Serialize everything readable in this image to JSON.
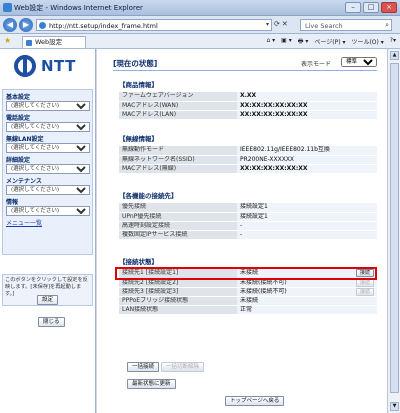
{
  "browser": {
    "window_title": "Web設定 - Windows Internet Explorer",
    "url": "http://ntt.setup/index_frame.html",
    "search_placeholder": "Live Search",
    "tab_title": "Web設定",
    "commands": [
      "⌂ ▾",
      "▣ ▾",
      "🖶 ▾",
      "ページ(P) ▾",
      "ツール(O) ▾",
      "?▾"
    ]
  },
  "left": {
    "logo_text": "NTT",
    "menu": [
      {
        "label": "基本設定",
        "select": "(選択してください)"
      },
      {
        "label": "電話設定",
        "select": "(選択してください)"
      },
      {
        "label": "無線LAN設定",
        "select": "(選択してください)"
      },
      {
        "label": "詳細設定",
        "select": "(選択してください)"
      },
      {
        "label": "メンテナンス",
        "select": "(選択してください)"
      },
      {
        "label": "情報",
        "select": "(選択してください)"
      }
    ],
    "menu_list_link": "メニュー一覧",
    "notice_text": "このボタンをクリックして設定を反映します。[未保存]を再起動します。]",
    "apply_button": "設定",
    "close_button": "閉じる"
  },
  "main": {
    "title": "[現在の状態]",
    "mode_label": "表示モード",
    "mode_value": "標準",
    "sections": {
      "product": {
        "heading": "【商品情報】",
        "rows": [
          {
            "k": "ファームウェアバージョン",
            "v": "X.XX"
          },
          {
            "k": "MACアドレス(WAN)",
            "v": "XX:XX:XX:XX:XX:XX"
          },
          {
            "k": "MACアドレス(LAN)",
            "v": "XX:XX:XX:XX:XX:XX"
          }
        ]
      },
      "wireless": {
        "heading": "【無線情報】",
        "rows": [
          {
            "k": "無線動作モード",
            "v": "IEEE802.11g/IEEE802.11b互換"
          },
          {
            "k": "無線ネットワーク名(SSID)",
            "v": "PR200NE-XXXXXX"
          },
          {
            "k": "MACアドレス(無線)",
            "v": "XX:XX:XX:XX:XX:XX"
          }
        ]
      },
      "priority": {
        "heading": "【各機能の接続先】",
        "rows": [
          {
            "k": "優先接続",
            "v": "接続設定1"
          },
          {
            "k": "UPnP優先接続",
            "v": "接続設定1"
          },
          {
            "k": "高速時刻設定接続",
            "v": "-"
          },
          {
            "k": "複数固定IPサービス接続",
            "v": "-"
          }
        ]
      },
      "connection": {
        "heading": "【接続状態】",
        "rows": [
          {
            "k": "接続先1 [接続設定1]",
            "v": "未接続",
            "action": "接続"
          },
          {
            "k": "接続先2 [接続設定2]",
            "v": "未接続(接続不可)",
            "action": "接続"
          },
          {
            "k": "接続先3 [接続設定3]",
            "v": "未接続(接続不可)",
            "action": "接続"
          },
          {
            "k": "PPPoEブリッジ接続状態",
            "v": "未接続"
          },
          {
            "k": "LAN接続状態",
            "v": "正常"
          }
        ]
      }
    },
    "buttons": {
      "connect_all": "一括接続",
      "disconnect_all": "一括切断解除",
      "refresh": "最新状態に更新",
      "top": "トップページへ戻る"
    }
  }
}
